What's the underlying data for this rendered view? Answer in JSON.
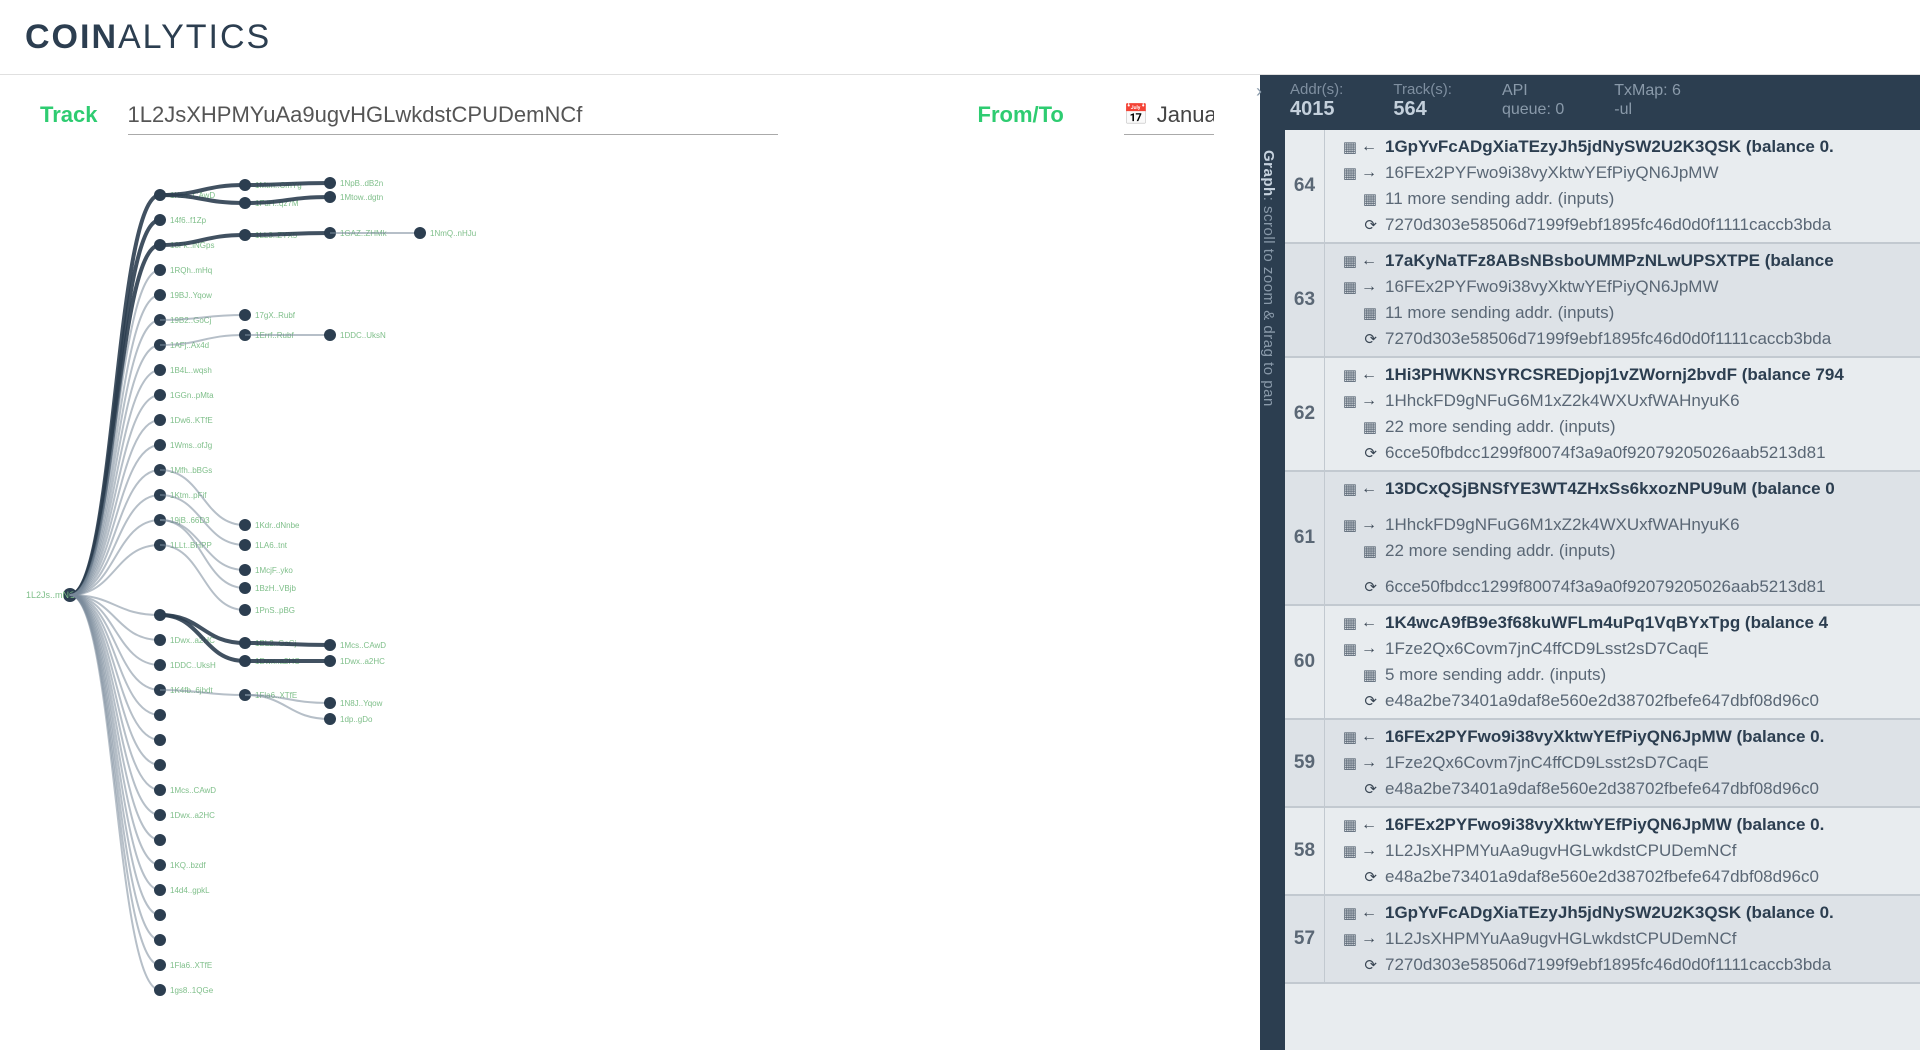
{
  "header": {
    "logo_bold": "COIN",
    "logo_light": "ALYTICS"
  },
  "controls": {
    "track_label": "Track",
    "track_value": "1L2JsXHPMYuAa9ugvHGLwkdstCPUDemNCf",
    "fromto_label": "From/To",
    "date_value": "January"
  },
  "panel": {
    "collapse": "›",
    "vertical_bold": "Graph",
    "vertical_rest": ": scroll to zoom & drag to pan",
    "stats": {
      "addr_label": "Addr(s):",
      "addr_value": "4015",
      "track_label": "Track(s):",
      "track_value": "564",
      "api_label": "API",
      "api_value": "queue: 0",
      "txmap_label": "TxMap: 6",
      "txmap_value": "-ul"
    }
  },
  "graph": {
    "root_label": "1L2Js..mNCf",
    "level1": [
      {
        "label": "1Ks4..CAwD"
      },
      {
        "label": "14f6..f1Zp"
      },
      {
        "label": "18Fk..iNGps"
      },
      {
        "label": "1RQh..mHq"
      },
      {
        "label": "19BJ..Yqow"
      },
      {
        "label": "19B2..GoCj"
      },
      {
        "label": "1AFj..Ax4d"
      },
      {
        "label": "1B4L..wqsh"
      },
      {
        "label": "1GGn..pMta"
      },
      {
        "label": "1Dw6..KTfE"
      },
      {
        "label": "1Wms..ofJg"
      },
      {
        "label": "1Mfh..bBGs"
      },
      {
        "label": "1Ktm..pFif"
      },
      {
        "label": "19jB..66D3"
      },
      {
        "label": "1LLt..BHPP"
      },
      {
        "label": ""
      },
      {
        "label": "1Dwx..a2HC"
      },
      {
        "label": "1DDC..UksH"
      },
      {
        "label": "1K4fb..6jbdt"
      },
      {
        "label": ""
      },
      {
        "label": ""
      },
      {
        "label": ""
      },
      {
        "label": "1Mcs..CAwD"
      },
      {
        "label": "1Dwx..a2HC"
      },
      {
        "label": ""
      },
      {
        "label": "1KQ..bzdf"
      },
      {
        "label": "14d4..gpkL"
      },
      {
        "label": ""
      },
      {
        "label": ""
      },
      {
        "label": "1Fla6..XTfE"
      },
      {
        "label": "1gs8..1QGe"
      }
    ],
    "level2a": [
      {
        "label": "1Mtm..CmYg"
      },
      {
        "label": "1FdH..qz7M"
      }
    ],
    "level2b": {
      "label": "1LL3..ZYX5"
    },
    "level2c": [
      {
        "label": "17gX..Rubf"
      },
      {
        "label": "1Errf..Rubf"
      }
    ],
    "level2d": [
      {
        "label": "1Kdr..dNnbe"
      },
      {
        "label": "1LA6..tnt"
      }
    ],
    "level2e": [
      {
        "label": "1McjF..yko"
      },
      {
        "label": "1BzH..VBjb"
      }
    ],
    "level2f": {
      "label": "1PnS..pBG"
    },
    "level2g": [
      {
        "label": "1BL2..GoCj"
      },
      {
        "label": "1Dwx..a2HC"
      }
    ],
    "level2h": {
      "label": "1Fla6..XTfE"
    },
    "level3a": [
      {
        "label": "1NpB..dB2n"
      },
      {
        "label": "1Mtow..dgtn"
      }
    ],
    "level3b": {
      "label": "1GAZ..ZHMk"
    },
    "level3c": {
      "label": "1DDC..UksN"
    },
    "level3d": [
      {
        "label": "1Mcs..CAwD"
      },
      {
        "label": "1Dwx..a2HC"
      }
    ],
    "level3e": [
      {
        "label": "1N8J..Yqow"
      },
      {
        "label": "1dp..gDo"
      }
    ],
    "level4a": {
      "label": "1NmQ..nHJu"
    }
  },
  "transactions": [
    {
      "num": "64",
      "main_addr": "1GpYvFcADgXiaTEzyJh5jdNySW2U2K3QSK",
      "main_suffix": " (balance 0.",
      "sub_addr": "16FEx2PYFwo9i38vyXktwYEfPiyQN6JpMW",
      "more": "11 more sending addr. (inputs)",
      "hash": "7270d303e58506d7199f9ebf1895fc46d0d0f1111caccb3bda"
    },
    {
      "num": "63",
      "main_addr": "17aKyNaTFz8ABsNBsboUMMPzNLwUPSXTPE",
      "main_suffix": " (balance",
      "sub_addr": "16FEx2PYFwo9i38vyXktwYEfPiyQN6JpMW",
      "more": "11 more sending addr. (inputs)",
      "hash": "7270d303e58506d7199f9ebf1895fc46d0d0f1111caccb3bda"
    },
    {
      "num": "62",
      "main_addr": "1Hi3PHWKNSYRCSREDjopj1vZWornj2bvdF",
      "main_suffix": " (balance 794",
      "sub_addr": "1HhckFD9gNFuG6M1xZ2k4WXUxfWAHnyuK6",
      "more": "22 more sending addr. (inputs)",
      "hash": "6cce50fbdcc1299f80074f3a9a0f92079205026aab5213d81"
    },
    {
      "num": "61",
      "main_addr": "13DCxQSjBNSfYE3WT4ZHxSs6kxozNPU9uM",
      "main_suffix": " (balance 0",
      "sub_addr": "1HhckFD9gNFuG6M1xZ2k4WXUxfWAHnyuK6",
      "more": "22 more sending addr. (inputs)",
      "hash": "6cce50fbdcc1299f80074f3a9a0f92079205026aab5213d81",
      "tall": true
    },
    {
      "num": "60",
      "main_addr": "1K4wcA9fB9e3f68kuWFLm4uPq1VqBYxTpg",
      "main_suffix": " (balance 4",
      "sub_addr": "1Fze2Qx6Covm7jnC4ffCD9Lsst2sD7CaqE",
      "more": "5 more sending addr. (inputs)",
      "hash": "e48a2be73401a9daf8e560e2d38702fbefe647dbf08d96c0"
    },
    {
      "num": "59",
      "main_addr": "16FEx2PYFwo9i38vyXktwYEfPiyQN6JpMW",
      "main_suffix": " (balance 0.",
      "sub_addr": "1Fze2Qx6Covm7jnC4ffCD9Lsst2sD7CaqE",
      "hash": "e48a2be73401a9daf8e560e2d38702fbefe647dbf08d96c0"
    },
    {
      "num": "58",
      "main_addr": "16FEx2PYFwo9i38vyXktwYEfPiyQN6JpMW",
      "main_suffix": " (balance 0.",
      "sub_addr": "1L2JsXHPMYuAa9ugvHGLwkdstCPUDemNCf",
      "hash": "e48a2be73401a9daf8e560e2d38702fbefe647dbf08d96c0"
    },
    {
      "num": "57",
      "main_addr": "1GpYvFcADgXiaTEzyJh5jdNySW2U2K3QSK",
      "main_suffix": " (balance 0.",
      "sub_addr": "1L2JsXHPMYuAa9ugvHGLwkdstCPUDemNCf",
      "hash": "7270d303e58506d7199f9ebf1895fc46d0d0f1111caccb3bda"
    }
  ]
}
